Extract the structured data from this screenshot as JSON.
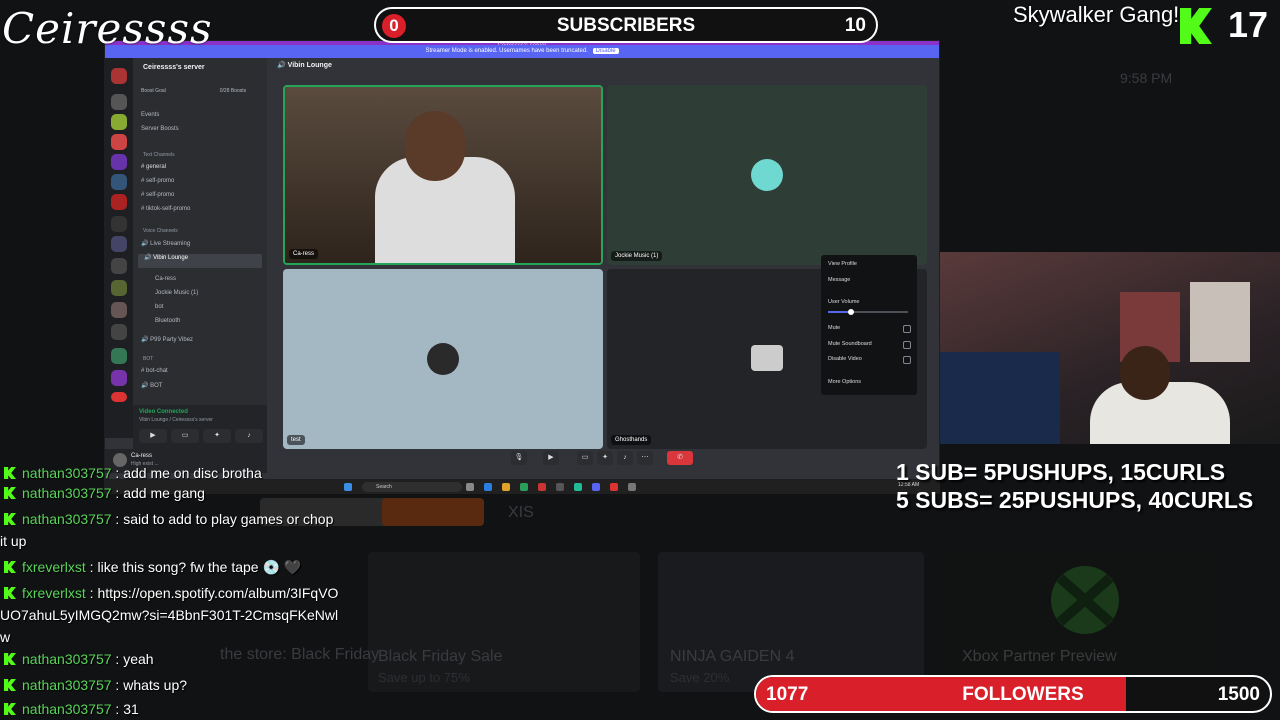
{
  "overlay": {
    "logo_text": "Ceiressss",
    "subscribers_goal": {
      "current": "0",
      "label": "SUBSCRIBERS",
      "target": "10",
      "progress": 0
    },
    "followers_goal": {
      "current": "1077",
      "label": "FOLLOWERS",
      "target": "1500",
      "progress": 0.72
    },
    "kick_alert": {
      "text": "Skywalker Gang!",
      "count": "17"
    },
    "pushups_rules": [
      "1 SUB= 5PUSHUPS, 15CURLS",
      "5 SUBS= 25PUSHUPS, 40CURLS"
    ],
    "accent_color": "#d81f2a",
    "kick_color": "#53fc18"
  },
  "background_dashboard": {
    "clock": "9:58 PM",
    "tiles": [
      "XIS",
      "Black Friday Sale",
      "Save up to 75%",
      "NINJA GAIDEN 4",
      "Save 20%",
      "Xbox Partner Preview",
      "the store: Black Friday"
    ]
  },
  "discord": {
    "window_title": "Ceiressss's server",
    "banner_text": "Streamer Mode is enabled. Usernames have been truncated.",
    "banner_button": "Disable",
    "server_name": "Ceiressss's server",
    "boost_goal": "Boost Goal",
    "boost_count": "0/28 Boosts",
    "menu": [
      "Events",
      "Server Boosts"
    ],
    "text_channels_label": "Text Channels",
    "channels": [
      "general",
      "self-promo",
      "self-promo",
      "tiktok-self-promo"
    ],
    "voice_channels_label": "Voice Channels",
    "voice_channels": [
      "Live Streaming",
      "Vibin Lounge",
      "P99 Party Vibez"
    ],
    "voice_members": [
      "Ca-ress",
      "Jockie Music (1)",
      "bot",
      "Bluetooth"
    ],
    "other_category": "BOT",
    "other_channels": [
      "bot-chat",
      "BOT"
    ],
    "voice_status": "Video Connected",
    "voice_sub": "Vibin Lounge / Ceiressss's server",
    "user_name": "Ca-ress",
    "user_status": "High exist ...",
    "channel_header": "Vibin Lounge",
    "tiles": [
      {
        "label": "Ca-ress"
      },
      {
        "label": "Jockie Music (1)"
      },
      {
        "label": "test"
      },
      {
        "label": "Ghosthands"
      }
    ],
    "context_menu": {
      "view_profile": "View Profile",
      "message": "Message",
      "user_volume": "User Volume",
      "mute": "Mute",
      "mute_soundboard": "Mute Soundboard",
      "disable_video": "Disable Video",
      "more_options": "More Options"
    }
  },
  "taskbar": {
    "search": "Search",
    "time": "12:58 AM"
  },
  "chat": [
    {
      "user": "nathan303757",
      "text": "add me on disc brotha"
    },
    {
      "user": "nathan303757",
      "text": "add me gang"
    },
    {
      "user": "nathan303757",
      "text": "said to add to play games or chop it up"
    },
    {
      "user": "fxreverlxst",
      "text": "like this song? fw the tape 💿 🖤"
    },
    {
      "user": "fxreverlxst",
      "text": "https://open.spotify.com/album/3IFqVOUO7ahuL5yIMGQ2mw?si=4BbnF301T-2CmsqFKeNwlw"
    },
    {
      "user": "nathan303757",
      "text": "yeah"
    },
    {
      "user": "nathan303757",
      "text": "whats up?"
    },
    {
      "user": "nathan303757",
      "text": "31"
    }
  ]
}
